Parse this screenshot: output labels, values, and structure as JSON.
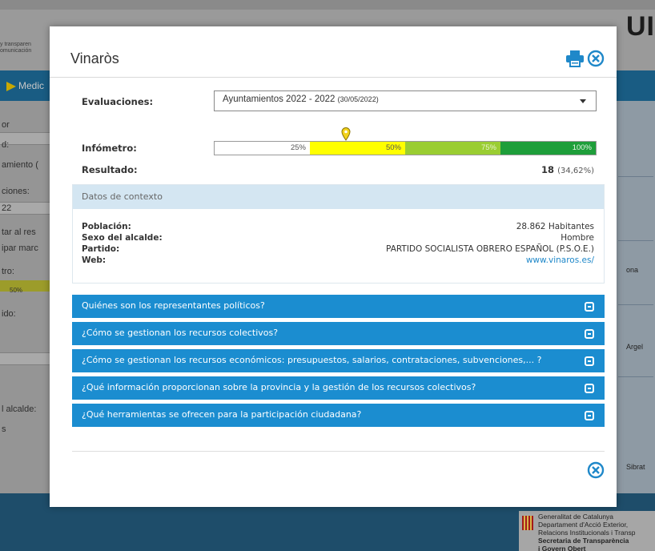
{
  "background": {
    "brand_lines": [
      "y transparen",
      "omunicación"
    ],
    "corner_logo": "UI",
    "nav_item": "Medic",
    "sidebar_items": [
      "or",
      "d:",
      "amiento (",
      "ciones:",
      "22",
      "tar al res",
      "ipar marc",
      "tro:",
      "ido:",
      "l alcalde:",
      "s"
    ],
    "sidebar_bar_text": "50%",
    "map_labels": [
      "Argel",
      "ona",
      "Sibrat"
    ],
    "generalitat_lines": [
      "Generalitat de Catalunya",
      "Departament d'Acció Exterior,",
      "Relacions Institucionals i Transp",
      "Secretaria de Transparència",
      "i Govern Obert"
    ]
  },
  "modal": {
    "title": "Vinaròs",
    "icons": {
      "print": "print-icon",
      "close": "close-circle-icon"
    },
    "evaluaciones": {
      "label": "Evaluaciones:",
      "selected": "Ayuntamientos 2022 - 2022",
      "selected_date": "(30/05/2022)"
    },
    "infometro": {
      "label": "Infómetro:",
      "marker_percent": 34.62,
      "segments": [
        {
          "label": "25%",
          "color": "#ffffff"
        },
        {
          "label": "50%",
          "color": "#ffff00"
        },
        {
          "label": "75%",
          "color": "#9acd32"
        },
        {
          "label": "100%",
          "color": "#1e9e3a"
        }
      ]
    },
    "resultado": {
      "label": "Resultado:",
      "value": "18",
      "percent": "(34,62%)"
    },
    "context": {
      "header": "Datos de contexto",
      "poblacion_label": "Población:",
      "poblacion_value": "28.862 Habitantes",
      "sexo_label": "Sexo del alcalde:",
      "sexo_value": "Hombre",
      "partido_label": "Partido:",
      "partido_value": "PARTIDO SOCIALISTA OBRERO ESPAÑOL (P.S.O.E.)",
      "web_label": "Web:",
      "web_value": "www.vinaros.es/"
    },
    "accordion": [
      "Quiénes son los representantes políticos?",
      "¿Cómo se gestionan los recursos colectivos?",
      "¿Cómo se gestionan los recursos económicos: presupuestos, salarios, contrataciones, subvenciones,... ?",
      "¿Qué información proporcionan sobre la provincia y la gestión de los recursos colectivos?",
      "¿Qué herramientas se ofrecen para la participación ciudadana?"
    ],
    "colors": {
      "accent": "#1b8dd0",
      "link": "#1f88c9",
      "context_header": "#d4e6f2"
    }
  }
}
